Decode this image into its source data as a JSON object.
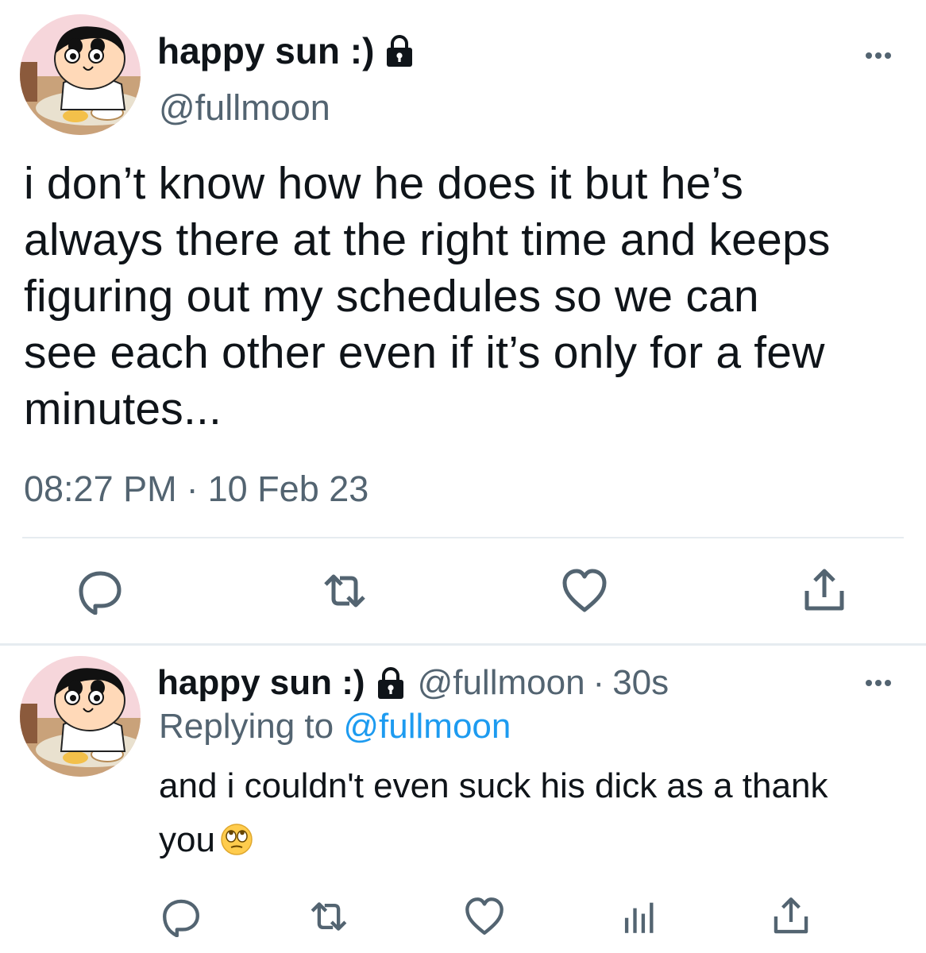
{
  "main_tweet": {
    "display_name": "happy sun :)",
    "handle": "@fullmoon",
    "text": "i don’t know how he does it but he’s\nalways there at the right time and keeps\nfiguring out my schedules so we can\nsee each other even if it’s only for a few\nminutes...",
    "time": "08:27 PM",
    "separator": "·",
    "date": "10 Feb 23",
    "icons": {
      "avatar": "cartoon-boy-avatar",
      "lock": "lock-icon",
      "more": "more-icon",
      "actions": [
        "reply-icon",
        "retweet-icon",
        "like-icon",
        "share-icon"
      ]
    }
  },
  "reply_tweet": {
    "display_name": "happy sun :)",
    "handle": "@fullmoon",
    "separator": "·",
    "time_ago": "30s",
    "replying_prefix": "Replying to",
    "replying_to": "@fullmoon",
    "text": "and i couldn't even suck his dick as a thank you",
    "emoji": "face-with-rolling-eyes",
    "icons": {
      "actions": [
        "reply-icon",
        "retweet-icon",
        "like-icon",
        "views-icon",
        "share-icon"
      ]
    }
  },
  "colors": {
    "text_primary": "#0f1419",
    "text_secondary": "#536471",
    "link": "#1d9bf0",
    "divider": "#e6ecf0",
    "icon": "#536471"
  }
}
